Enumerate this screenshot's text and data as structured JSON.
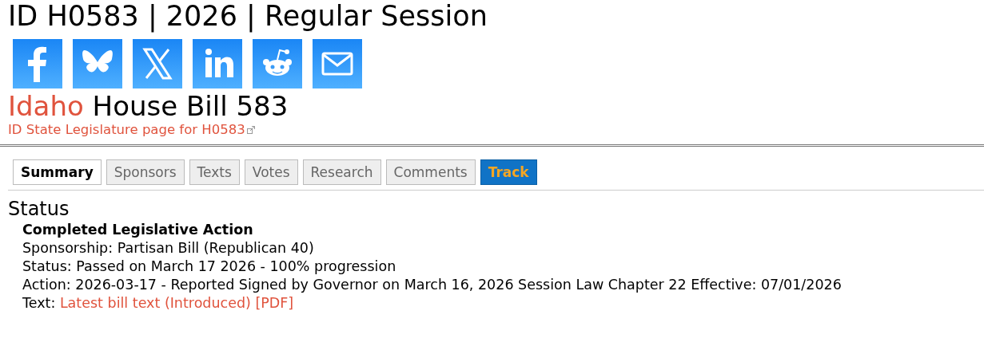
{
  "page_title": "ID H0583 | 2026 | Regular Session",
  "share_icons": [
    {
      "kind": "facebook"
    },
    {
      "kind": "bluesky"
    },
    {
      "kind": "x"
    },
    {
      "kind": "linkedin"
    },
    {
      "kind": "reddit"
    },
    {
      "kind": "email"
    }
  ],
  "heading": {
    "state": "Idaho",
    "title": "House Bill 583"
  },
  "legislature_link": "ID State Legislature page for H0583",
  "tabs": [
    {
      "label": "Summary",
      "selected": true,
      "kind": "tab"
    },
    {
      "label": "Sponsors",
      "selected": false,
      "kind": "tab"
    },
    {
      "label": "Texts",
      "selected": false,
      "kind": "tab"
    },
    {
      "label": "Votes",
      "selected": false,
      "kind": "tab"
    },
    {
      "label": "Research",
      "selected": false,
      "kind": "tab"
    },
    {
      "label": "Comments",
      "selected": false,
      "kind": "tab"
    },
    {
      "label": "Track",
      "selected": false,
      "kind": "action"
    }
  ],
  "status": {
    "heading": "Status",
    "summary": "Completed Legislative Action",
    "lines": [
      "Sponsorship: Partisan Bill (Republican 40)",
      "Status: Passed on March 17 2026 - 100% progression",
      "Action: 2026-03-17 - Reported Signed by Governor on March 16, 2026 Session Law Chapter 22 Effective: 07/01/2026"
    ],
    "text_label": "Text:",
    "text_link": "Latest bill text (Introduced) [PDF]"
  }
}
